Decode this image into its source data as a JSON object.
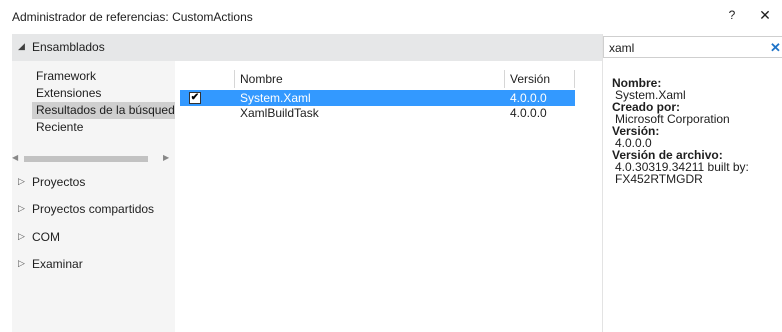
{
  "window": {
    "title": "Administrador de referencias: CustomActions",
    "help": "?",
    "close": "✕"
  },
  "left": {
    "header": {
      "icon": "◢",
      "label": "Ensamblados"
    },
    "subitems": [
      {
        "label": "Framework"
      },
      {
        "label": "Extensiones"
      },
      {
        "label": "Resultados de la búsqueda"
      },
      {
        "label": "Reciente"
      }
    ],
    "groups": [
      {
        "icon": "▷",
        "label": "Proyectos"
      },
      {
        "icon": "▷",
        "label": "Proyectos compartidos"
      },
      {
        "icon": "▷",
        "label": "COM"
      },
      {
        "icon": "▷",
        "label": "Examinar"
      }
    ],
    "scroll": {
      "left": "◀",
      "right": "▶"
    }
  },
  "table": {
    "headers": [
      "Nombre",
      "Versión"
    ],
    "rows": [
      {
        "checked": true,
        "check_glyph": "✔",
        "name": "System.Xaml",
        "version": "4.0.0.0"
      },
      {
        "checked": false,
        "check_glyph": "",
        "name": "XamlBuildTask",
        "version": "4.0.0.0"
      }
    ]
  },
  "search": {
    "value": "xaml",
    "clear": "✕"
  },
  "details": {
    "name_label": "Nombre:",
    "name": "System.Xaml",
    "created_label": "Creado por:",
    "created": "Microsoft Corporation",
    "version_label": "Versión:",
    "version": "4.0.0.0",
    "file_version_label": "Versión de archivo:",
    "file_version": "4.0.30319.34211 built by: FX452RTMGDR"
  },
  "colors": {
    "accent": "#3399ff",
    "panel": "#f5f5f5",
    "header": "#e6e7e8",
    "desktop": "#a9b88f"
  }
}
